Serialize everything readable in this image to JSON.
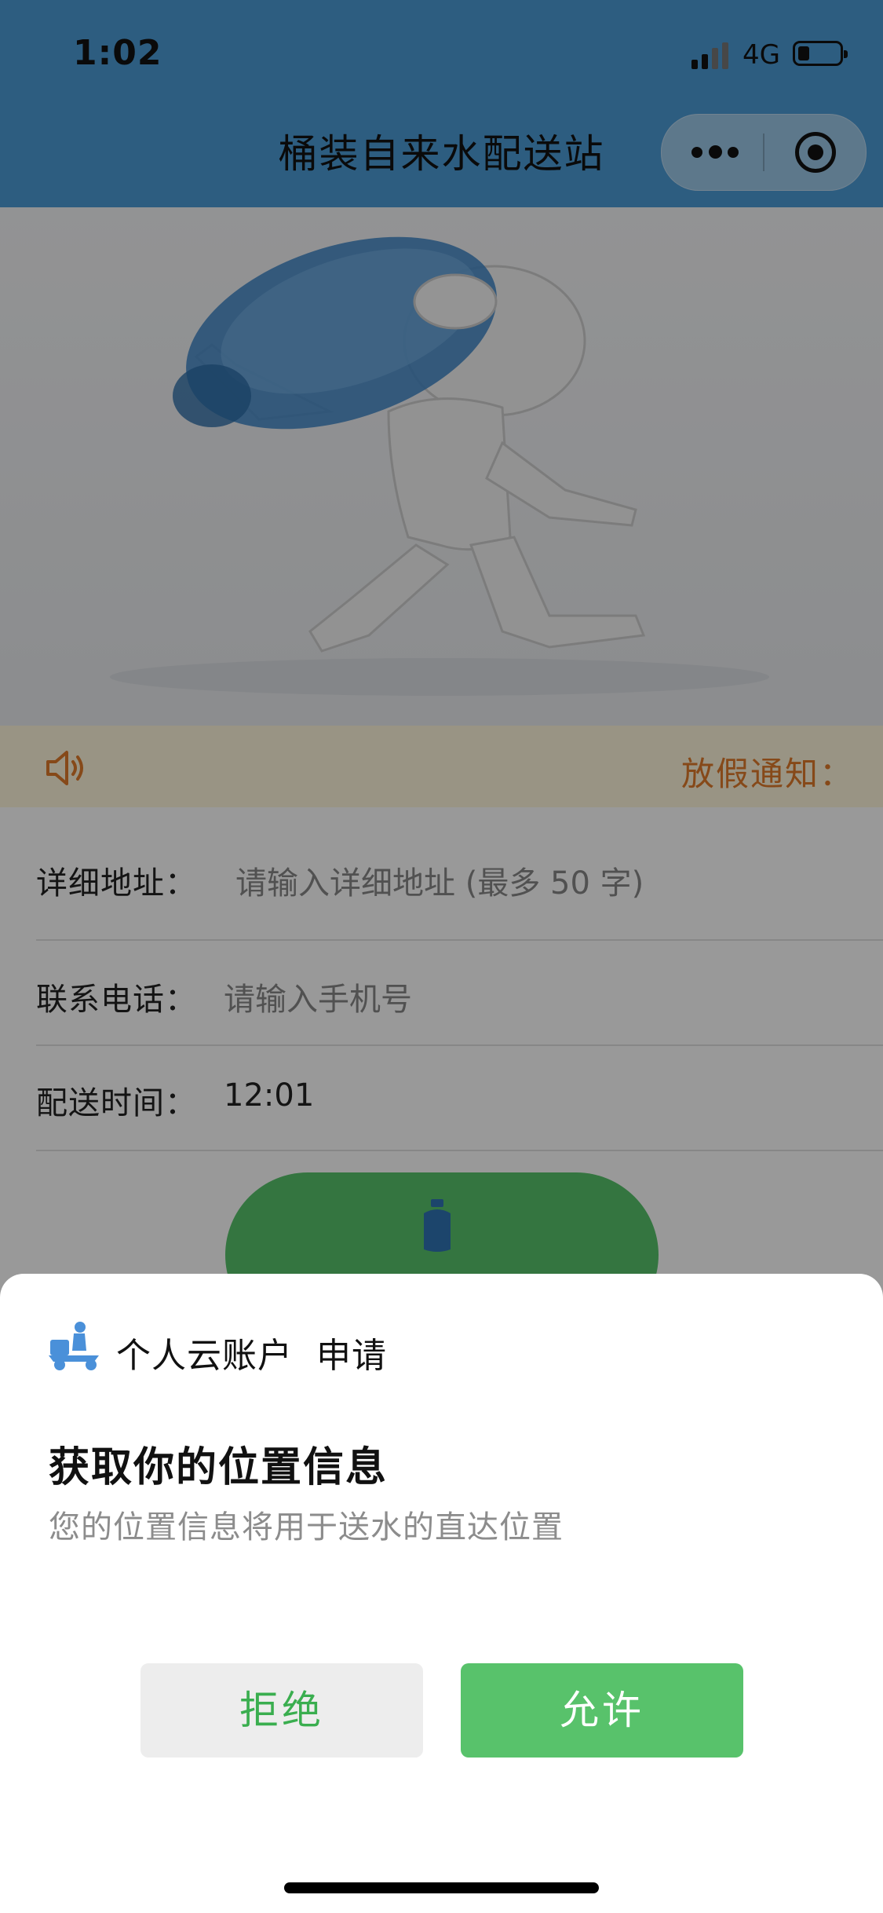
{
  "status_bar": {
    "time": "1:02",
    "network": "4G"
  },
  "nav": {
    "title": "桶装自来水配送站"
  },
  "notice": {
    "text": "放假通知："
  },
  "form": {
    "address_label": "详细地址：",
    "address_placeholder": "请输入详细地址 (最多 50 字)",
    "phone_label": "联系电话：",
    "phone_placeholder": "请输入手机号",
    "time_label": "配送时间：",
    "time_value": "12:01"
  },
  "dialog": {
    "app_name": "个人云账户  申请",
    "title": "获取你的位置信息",
    "description": "您的位置信息将用于送水的直达位置",
    "deny_label": "拒绝",
    "allow_label": "允许"
  },
  "colors": {
    "nav_background": "#4b9bd6",
    "accent_green": "#58c26b",
    "notice_orange": "#e07b2b"
  },
  "icons": {
    "speaker": "speaker-icon",
    "water_jug": "water-jug-icon",
    "delivery": "delivery-scooter-icon",
    "more": "more-dots-icon",
    "close": "target-circle-icon"
  }
}
